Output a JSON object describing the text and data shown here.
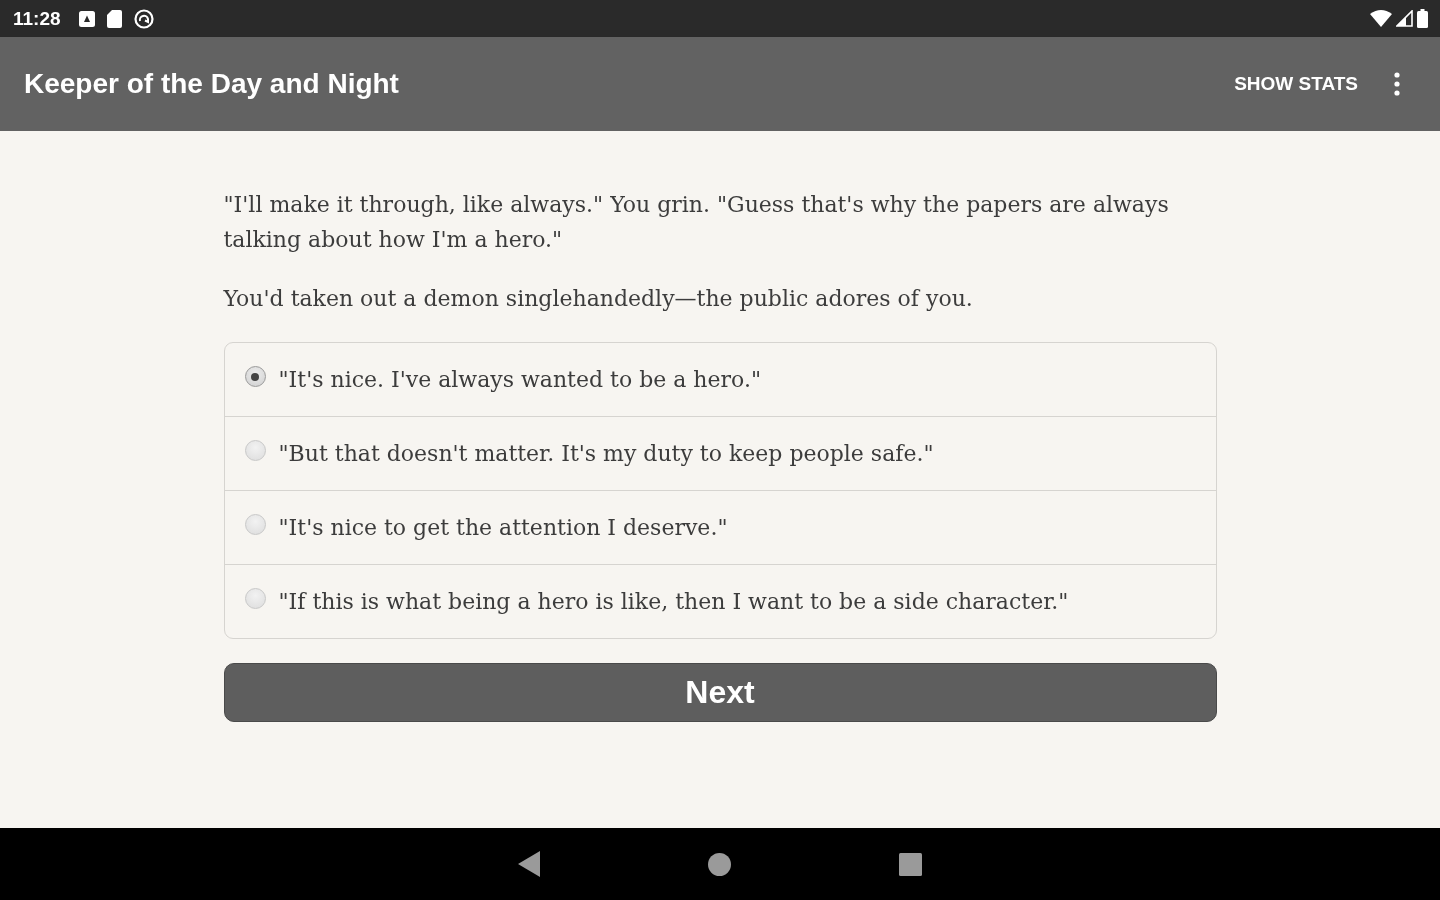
{
  "status_bar": {
    "time": "11:28"
  },
  "app_bar": {
    "title": "Keeper of the Day and Night",
    "action": "SHOW STATS"
  },
  "story": {
    "paragraphs": [
      "\"I'll make it through, like always.\" You grin. \"Guess that's why the papers are always talking about how I'm a hero.\"",
      "You'd taken out a demon singlehandedly—the public adores of you."
    ]
  },
  "choices": [
    {
      "text": "\"It's nice. I've always wanted to be a hero.\"",
      "selected": true
    },
    {
      "text": "\"But that doesn't matter. It's my duty to keep people safe.\"",
      "selected": false
    },
    {
      "text": "\"It's nice to get the attention I deserve.\"",
      "selected": false
    },
    {
      "text": "\"If this is what being a hero is like, then I want to be a side character.\"",
      "selected": false
    }
  ],
  "next_button": {
    "label": "Next"
  }
}
